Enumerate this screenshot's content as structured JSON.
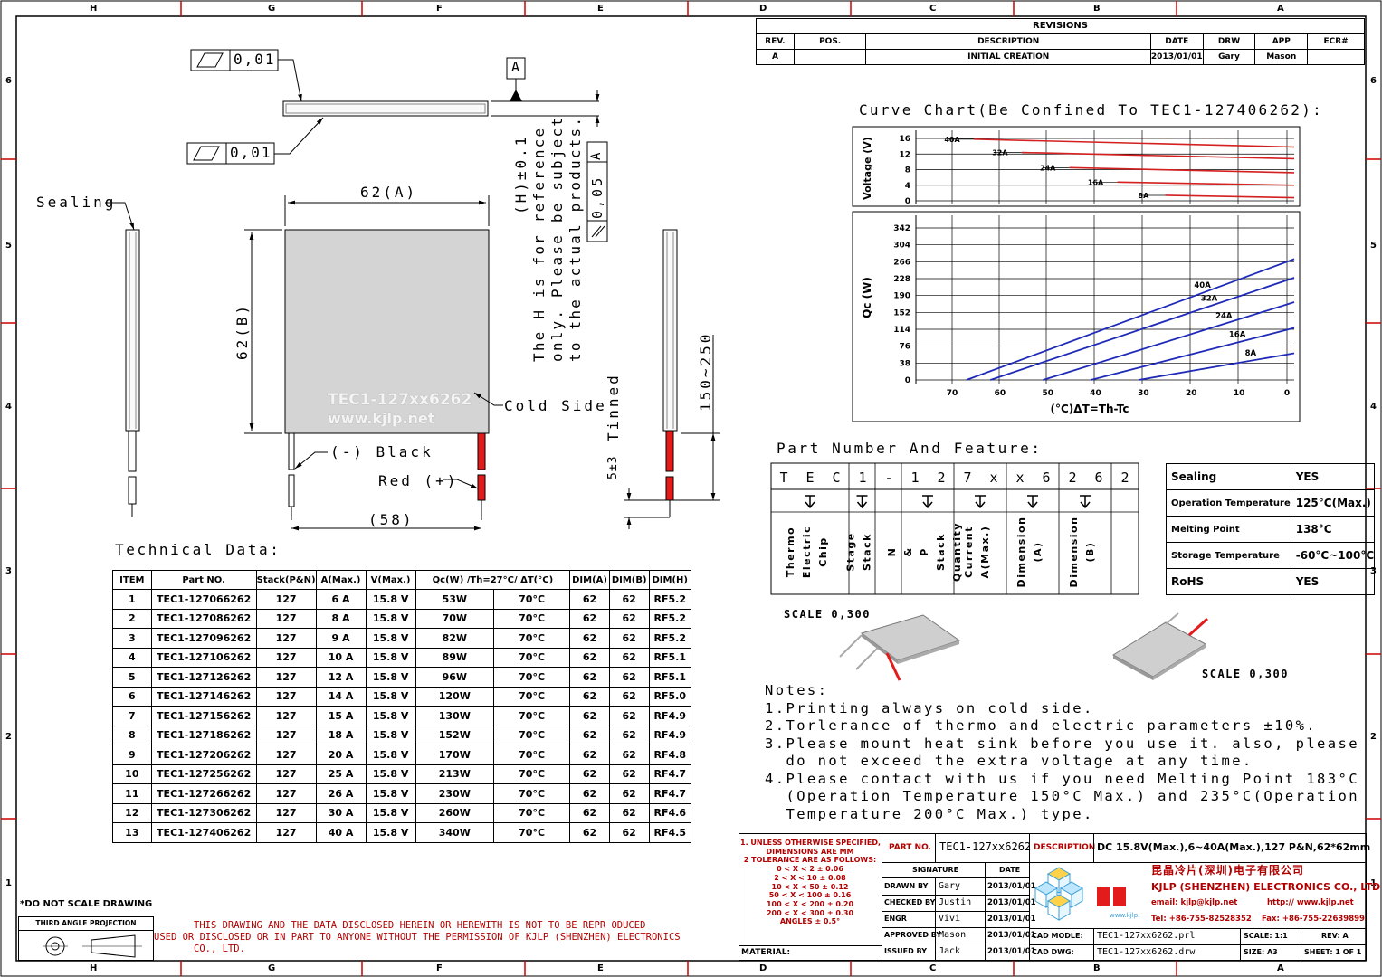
{
  "border": {
    "columns": [
      "H",
      "G",
      "F",
      "E",
      "D",
      "C",
      "B",
      "A"
    ],
    "rows": [
      "6",
      "5",
      "4",
      "3",
      "2",
      "1"
    ]
  },
  "revisions": {
    "title": "REVISIONS",
    "headers": [
      "REV.",
      "POS.",
      "DESCRIPTION",
      "DATE",
      "DRW",
      "APP",
      "ECR#"
    ],
    "rows": [
      [
        "A",
        "",
        "INITIAL CREATION",
        "2013/01/01",
        "Gary",
        "Mason",
        ""
      ]
    ]
  },
  "drawing": {
    "flatness_value": "0,01",
    "datum": "A",
    "parallel_value": "0,05",
    "parallel_datum": "A",
    "sealing": "Sealing",
    "width_dim": "62(A)",
    "height_dim": "62(B)",
    "module_print": "TEC1-127xx6262",
    "module_url": "www.kjlp.net",
    "cold_side": "Cold Side",
    "black_lead": "(-) Black",
    "red_lead": "Red (+)",
    "lead_dim": "(58)",
    "h_note": [
      "(H)±0.1",
      "The H is for reference",
      "only. Please be subject",
      "to the actual products."
    ],
    "tinned": "Tinned",
    "tinned_dim": "5±3",
    "wire_dim": "150~250"
  },
  "chart_data": [
    {
      "type": "line",
      "title": "Curve Chart(Be Confined To TEC1-127406262):",
      "ylabel": "Voltage (V)",
      "xlabel": "",
      "x_axis": "reversed",
      "y_ticks": [
        16,
        12,
        8,
        4,
        0
      ],
      "ylim": [
        0,
        16
      ],
      "xlim": [
        0,
        70
      ],
      "grid": true,
      "series": [
        {
          "name": "40A",
          "x": [
            70,
            0
          ],
          "y": [
            15.8,
            13.8
          ]
        },
        {
          "name": "32A",
          "x": [
            60,
            0
          ],
          "y": [
            12.4,
            10.8
          ]
        },
        {
          "name": "24A",
          "x": [
            50,
            0
          ],
          "y": [
            8.5,
            7.2
          ]
        },
        {
          "name": "16A",
          "x": [
            40,
            0
          ],
          "y": [
            4.8,
            4.0
          ]
        },
        {
          "name": "8A",
          "x": [
            30,
            0
          ],
          "y": [
            1.4,
            0.8
          ]
        }
      ]
    },
    {
      "type": "line",
      "ylabel": "Qc (W)",
      "xlabel": "(°C)ΔT=Th-Tc",
      "x_axis": "reversed",
      "x_ticks": [
        70,
        60,
        50,
        40,
        30,
        20,
        10,
        0
      ],
      "y_ticks": [
        342,
        304,
        266,
        228,
        190,
        152,
        114,
        76,
        38,
        0
      ],
      "ylim": [
        0,
        342
      ],
      "xlim": [
        0,
        70
      ],
      "grid": true,
      "series": [
        {
          "name": "40A",
          "x": [
            67,
            0
          ],
          "y": [
            0,
            272
          ]
        },
        {
          "name": "32A",
          "x": [
            62,
            0
          ],
          "y": [
            0,
            230
          ]
        },
        {
          "name": "24A",
          "x": [
            51,
            0
          ],
          "y": [
            0,
            175
          ]
        },
        {
          "name": "16A",
          "x": [
            41,
            0
          ],
          "y": [
            0,
            117
          ]
        },
        {
          "name": "8A",
          "x": [
            31,
            0
          ],
          "y": [
            0,
            60
          ]
        }
      ]
    },
    {
      "type": "table",
      "title": "Technical Data:",
      "headers": [
        "ITEM",
        "Part NO.",
        "Stack(P&N)",
        "A(Max.)",
        "V(Max.)",
        "Qc(W) /Th=27°C/ ΔT(°C)",
        "",
        "DIM(A)",
        "DIM(B)",
        "DIM(H)"
      ],
      "rows": [
        [
          "1",
          "TEC1-127066262",
          "127",
          "6 A",
          "15.8 V",
          "53W",
          "70°C",
          "62",
          "62",
          "RF5.2"
        ],
        [
          "2",
          "TEC1-127086262",
          "127",
          "8 A",
          "15.8 V",
          "70W",
          "70°C",
          "62",
          "62",
          "RF5.2"
        ],
        [
          "3",
          "TEC1-127096262",
          "127",
          "9 A",
          "15.8 V",
          "82W",
          "70°C",
          "62",
          "62",
          "RF5.2"
        ],
        [
          "4",
          "TEC1-127106262",
          "127",
          "10 A",
          "15.8 V",
          "89W",
          "70°C",
          "62",
          "62",
          "RF5.1"
        ],
        [
          "5",
          "TEC1-127126262",
          "127",
          "12 A",
          "15.8 V",
          "96W",
          "70°C",
          "62",
          "62",
          "RF5.1"
        ],
        [
          "6",
          "TEC1-127146262",
          "127",
          "14 A",
          "15.8 V",
          "120W",
          "70°C",
          "62",
          "62",
          "RF5.0"
        ],
        [
          "7",
          "TEC1-127156262",
          "127",
          "15 A",
          "15.8 V",
          "130W",
          "70°C",
          "62",
          "62",
          "RF4.9"
        ],
        [
          "8",
          "TEC1-127186262",
          "127",
          "18 A",
          "15.8 V",
          "152W",
          "70°C",
          "62",
          "62",
          "RF4.9"
        ],
        [
          "9",
          "TEC1-127206262",
          "127",
          "20 A",
          "15.8 V",
          "170W",
          "70°C",
          "62",
          "62",
          "RF4.8"
        ],
        [
          "10",
          "TEC1-127256262",
          "127",
          "25 A",
          "15.8 V",
          "213W",
          "70°C",
          "62",
          "62",
          "RF4.7"
        ],
        [
          "11",
          "TEC1-127266262",
          "127",
          "26 A",
          "15.8 V",
          "230W",
          "70°C",
          "62",
          "62",
          "RF4.7"
        ],
        [
          "12",
          "TEC1-127306262",
          "127",
          "30 A",
          "15.8 V",
          "260W",
          "70°C",
          "62",
          "62",
          "RF4.6"
        ],
        [
          "13",
          "TEC1-127406262",
          "127",
          "40 A",
          "15.8 V",
          "340W",
          "70°C",
          "62",
          "62",
          "RF4.5"
        ]
      ]
    }
  ],
  "feature": {
    "title": "Part Number And Feature:",
    "chars": [
      "T",
      "E",
      "C",
      "1",
      "-",
      "1",
      "2",
      "7",
      "x",
      "x",
      "6",
      "2",
      "6",
      "2"
    ],
    "desc": [
      "Thermo Electric Chip",
      "Stage Stack",
      "N & P Stack Quantity",
      "Current A(Max.)",
      "Dimension (A)",
      "Dimension (B)"
    ],
    "props": [
      [
        "Sealing",
        "YES"
      ],
      [
        "Operation Temperature",
        "125°C(Max.)"
      ],
      [
        "Melting Point",
        "138°C"
      ],
      [
        "Storage Temperature",
        "-60°C~100°C"
      ],
      [
        "RoHS",
        "YES"
      ]
    ]
  },
  "scale_label": "SCALE 0,300",
  "notes": {
    "title": "Notes:",
    "lines": [
      "1.Printing always on cold side.",
      "2.Torlerance of thermo and electric parameters ±10%.",
      "3.Please mount heat sink before you use it. also, please",
      "  do not exceed the extra voltage at any time.",
      "4.Please contact with us if you need Melting Point 183°C",
      "  (Operation Temperature 150°C Max.) and 235°C(Operation",
      "  Temperature 200°C Max.) type."
    ]
  },
  "title_block": {
    "tolerances": [
      "1. UNLESS OTHERWISE SPECIFIED,",
      "DIMENSIONS ARE MM",
      "2 TOLERANCE ARE AS FOLLOWS:",
      "0 < X <  2  ± 0.06",
      "2 < X <  10  ± 0.08",
      "10 < X <  50  ± 0.12",
      "50 < X < 100  ± 0.16",
      "100 < X < 200  ± 0.20",
      "200 < X < 300  ± 0.30",
      "ANGLES ± 0.5°"
    ],
    "part_no_label": "PART NO.",
    "part_no": "TEC1-127xx6262",
    "description_label": "DESCRIPTION",
    "description": "DC 15.8V(Max.),6~40A(Max.),127 P&N,62*62mm",
    "signature_label": "SIGNATURE",
    "date_label": "DATE",
    "sign_rows": [
      [
        "DRAWN BY",
        "Gary",
        "2013/01/01"
      ],
      [
        "CHECKED BY",
        "Justin",
        "2013/01/01"
      ],
      [
        "ENGR",
        "Vivi",
        "2013/01/01"
      ],
      [
        "APPROVED BY",
        "Mason",
        "2013/01/01"
      ],
      [
        "ISSUED BY",
        "Jack",
        "2013/01/01"
      ]
    ],
    "company_cn": "昆晶冷片(深圳)电子有限公司",
    "company_en": "KJLP (SHENZHEN) ELECTRONICS CO., LTD",
    "email": "email: kjlp@kjlp.net",
    "http": "http:// www.kjlp.net",
    "tel": "Tel: +86-755-82528352",
    "fax": "Fax: +86-755-22639899",
    "logo_url": "www.kjlp.net",
    "cad_model_label": "CAD MODLE:",
    "cad_model": "TEC1-127xx6262.prl",
    "cad_dwg_label": "CAD DWG:",
    "cad_dwg": "TEC1-127xx6262.drw",
    "scale": "SCALE: 1:1",
    "size": "SIZE: A3",
    "rev": "REV: A",
    "sheet": "SHEET: 1 OF 1",
    "material_label": "MATERIAL:",
    "no_scale": "*DO NOT SCALE DRAWING",
    "projection": "THIRD ANGLE PROJECTION",
    "disclaimer": [
      "THIS DRAWING AND THE DATA DISCLOSED HEREIN OR HEREWITH IS NOT TO BE REPR ODUCED",
      "USED OR DISCLOSED OR IN PART TO ANYONE WITHOUT THE PERMISSION OF KJLP (SHENZHEN) ELECTRONICS",
      "CO., LTD."
    ]
  }
}
